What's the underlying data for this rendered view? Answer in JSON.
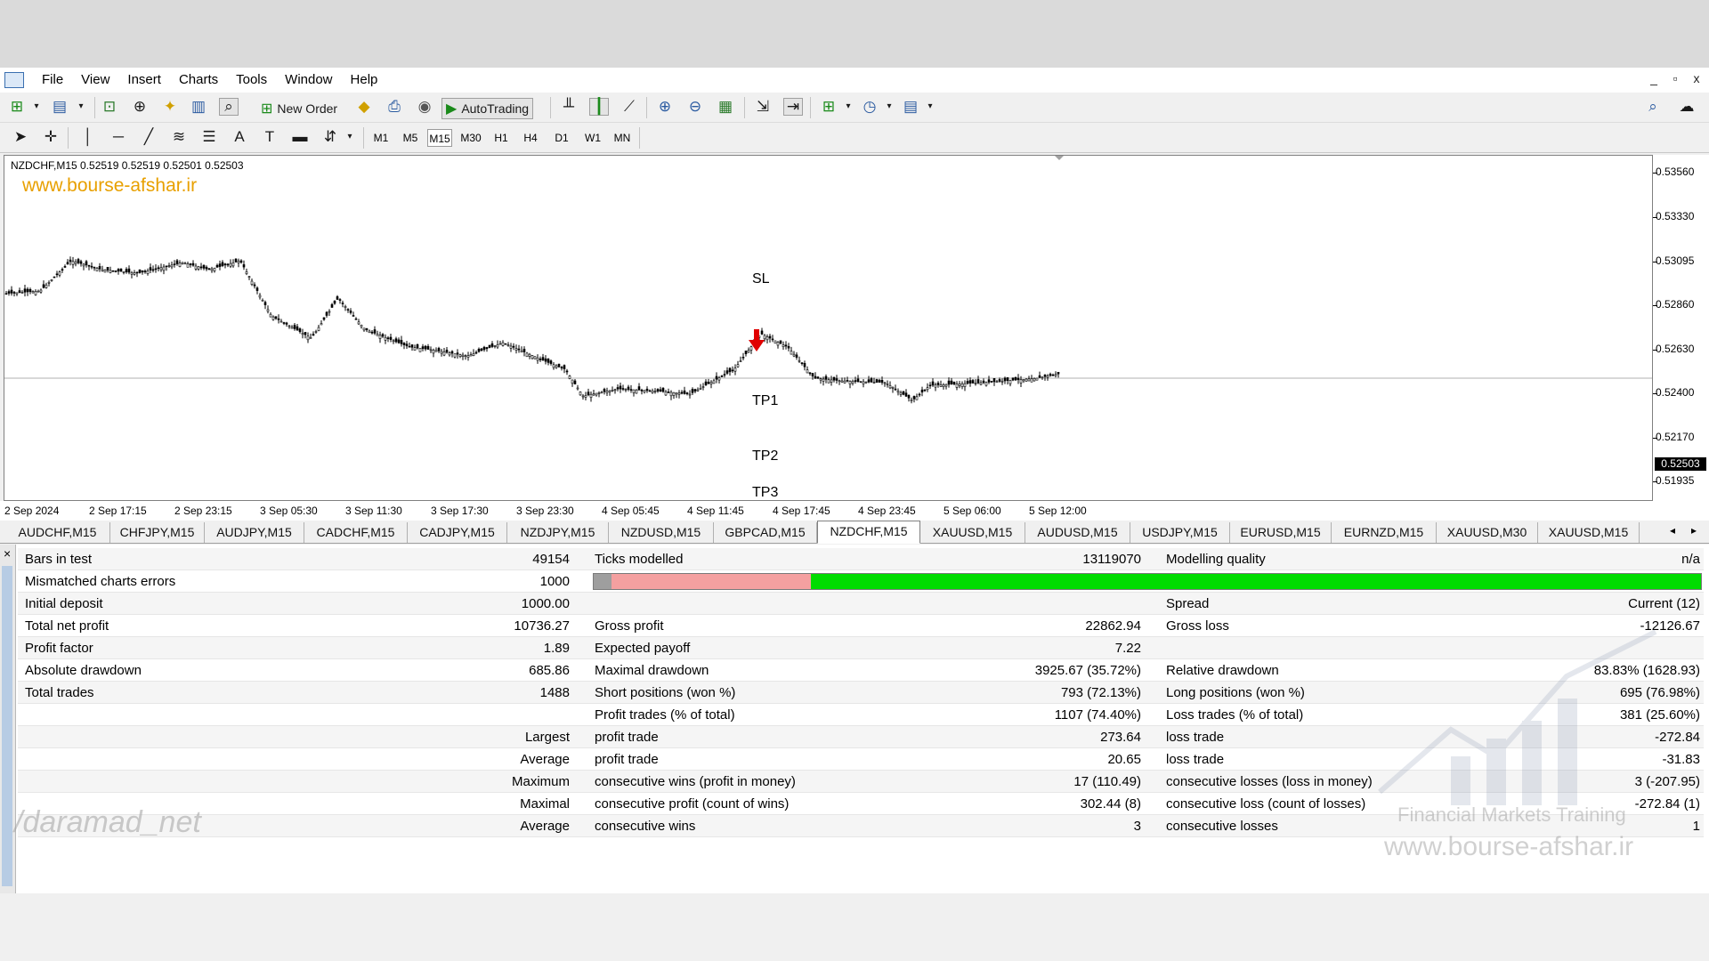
{
  "menu": [
    "File",
    "View",
    "Insert",
    "Charts",
    "Tools",
    "Window",
    "Help"
  ],
  "window_controls": [
    "_",
    "▫",
    "x"
  ],
  "toolbar": {
    "new_order": "New Order",
    "auto_trading": "AutoTrading"
  },
  "timeframes": [
    "M1",
    "M5",
    "M15",
    "M30",
    "H1",
    "H4",
    "D1",
    "W1",
    "MN"
  ],
  "active_timeframe": "M15",
  "chart": {
    "title": "NZDCHF,M15  0.52519 0.52519 0.52501 0.52503",
    "watermark": "www.bourse-afshar.ir",
    "labels": {
      "sl": "SL",
      "tp1": "TP1",
      "tp2": "TP2",
      "tp3": "TP3"
    },
    "current_price": "0.52503",
    "y_ticks": [
      "0.53560",
      "0.53330",
      "0.53095",
      "0.52860",
      "0.52630",
      "0.52400",
      "0.52170",
      "0.51935"
    ],
    "x_ticks": [
      "2 Sep 2024",
      "2 Sep 17:15",
      "2 Sep 23:15",
      "3 Sep 05:30",
      "3 Sep 11:30",
      "3 Sep 17:30",
      "3 Sep 23:30",
      "4 Sep 05:45",
      "4 Sep 11:45",
      "4 Sep 17:45",
      "4 Sep 23:45",
      "5 Sep 06:00",
      "5 Sep 12:00"
    ]
  },
  "tabs": [
    "AUDCHF,M15",
    "CHFJPY,M15",
    "AUDJPY,M15",
    "CADCHF,M15",
    "CADJPY,M15",
    "NZDJPY,M15",
    "NZDUSD,M15",
    "GBPCAD,M15",
    "NZDCHF,M15",
    "XAUUSD,M15",
    "AUDUSD,M15",
    "USDJPY,M15",
    "EURUSD,M15",
    "EURNZD,M15",
    "XAUUSD,M30",
    "XAUUSD,M15"
  ],
  "active_tab": "NZDCHF,M15",
  "tester_close": "×",
  "report": {
    "bars_in_test": {
      "label": "Bars in test",
      "value": "49154"
    },
    "ticks_modelled": {
      "label": "Ticks modelled",
      "value": "13119070"
    },
    "modelling_quality": {
      "label": "Modelling quality",
      "value": "n/a"
    },
    "mismatched": {
      "label": "Mismatched charts errors",
      "value": "1000"
    },
    "quality_bar": {
      "grey": 0.016,
      "pink": 0.18,
      "green": 0.804
    },
    "initial_deposit": {
      "label": "Initial deposit",
      "value": "1000.00"
    },
    "spread": {
      "label": "Spread",
      "value": "Current (12)"
    },
    "total_net_profit": {
      "label": "Total net profit",
      "value": "10736.27"
    },
    "gross_profit": {
      "label": "Gross profit",
      "value": "22862.94"
    },
    "gross_loss": {
      "label": "Gross loss",
      "value": "-12126.67"
    },
    "profit_factor": {
      "label": "Profit factor",
      "value": "1.89"
    },
    "expected_payoff": {
      "label": "Expected payoff",
      "value": "7.22"
    },
    "absolute_drawdown": {
      "label": "Absolute drawdown",
      "value": "685.86"
    },
    "maximal_drawdown": {
      "label": "Maximal drawdown",
      "value": "3925.67 (35.72%)"
    },
    "relative_drawdown": {
      "label": "Relative drawdown",
      "value": "83.83% (1628.93)"
    },
    "total_trades": {
      "label": "Total trades",
      "value": "1488"
    },
    "short_positions": {
      "label": "Short positions (won %)",
      "value": "793 (72.13%)"
    },
    "long_positions": {
      "label": "Long positions (won %)",
      "value": "695 (76.98%)"
    },
    "profit_trades": {
      "label": "Profit trades (% of total)",
      "value": "1107 (74.40%)"
    },
    "loss_trades": {
      "label": "Loss trades (% of total)",
      "value": "381 (25.60%)"
    },
    "largest": {
      "label": "Largest",
      "profit_label": "profit trade",
      "profit_value": "273.64",
      "loss_label": "loss trade",
      "loss_value": "-272.84"
    },
    "average": {
      "label": "Average",
      "profit_label": "profit trade",
      "profit_value": "20.65",
      "loss_label": "loss trade",
      "loss_value": "-31.83"
    },
    "maximum": {
      "label": "Maximum",
      "wins_label": "consecutive wins (profit in money)",
      "wins_value": "17 (110.49)",
      "losses_label": "consecutive losses (loss in money)",
      "losses_value": "3 (-207.95)"
    },
    "maximal": {
      "label": "Maximal",
      "wins_label": "consecutive profit (count of wins)",
      "wins_value": "302.44 (8)",
      "losses_label": "consecutive loss (count of losses)",
      "losses_value": "-272.84 (1)"
    },
    "average_consec": {
      "label": "Average",
      "wins_label": "consecutive wins",
      "wins_value": "3",
      "losses_label": "consecutive losses",
      "losses_value": "1"
    }
  },
  "watermarks": {
    "daramad": "/daramad_net",
    "subtitle": "Financial Markets Training",
    "url": "www.bourse-afshar.ir"
  },
  "colors": {
    "price_up_arrow": "#e00000",
    "quality_green": "#00dc00",
    "quality_pink": "#f4a0a0",
    "watermark_orange": "#e8a000"
  }
}
